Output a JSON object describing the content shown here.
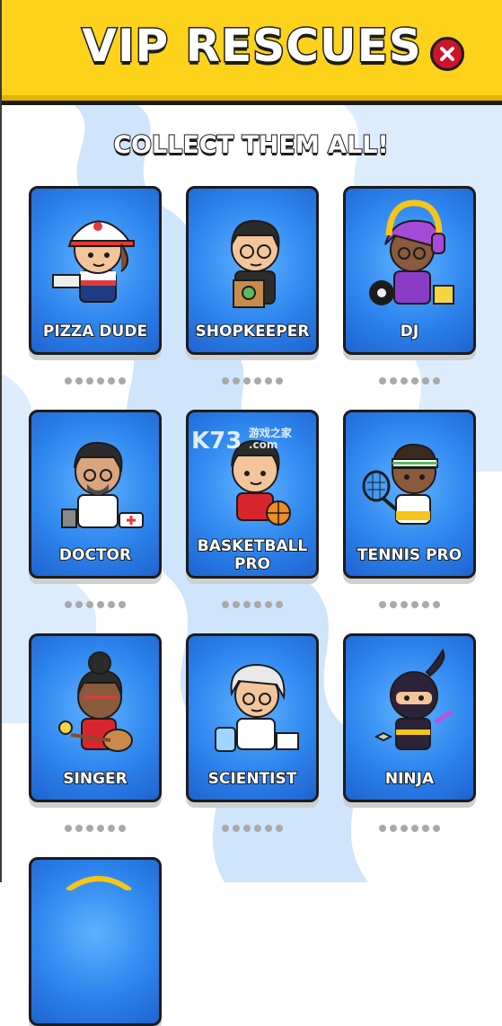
{
  "header": {
    "title": "VIP RESCUES",
    "close_icon": "close-x-icon"
  },
  "subtitle": "COLLECT THEM ALL!",
  "watermark": {
    "main": "K73",
    "sub": "游戏之家",
    "domain": ".com"
  },
  "cards": [
    {
      "label": "PIZZA DUDE",
      "icon": "pizza-dude-icon",
      "progress_dots": 6
    },
    {
      "label": "SHOPKEEPER",
      "icon": "shopkeeper-icon",
      "progress_dots": 6
    },
    {
      "label": "DJ",
      "icon": "dj-icon",
      "progress_dots": 6
    },
    {
      "label": "DOCTOR",
      "icon": "doctor-icon",
      "progress_dots": 6
    },
    {
      "label_line1": "BASKETBALL",
      "label_line2": "PRO",
      "icon": "basketball-pro-icon",
      "progress_dots": 6
    },
    {
      "label": "TENNIS PRO",
      "icon": "tennis-pro-icon",
      "progress_dots": 6
    },
    {
      "label": "SINGER",
      "icon": "singer-icon",
      "progress_dots": 6
    },
    {
      "label": "SCIENTIST",
      "icon": "scientist-icon",
      "progress_dots": 6
    },
    {
      "label": "NINJA",
      "icon": "ninja-icon",
      "progress_dots": 6
    }
  ],
  "colors": {
    "header": "#fdd21b",
    "card": "#2e86ee",
    "close": "#d0122b"
  }
}
